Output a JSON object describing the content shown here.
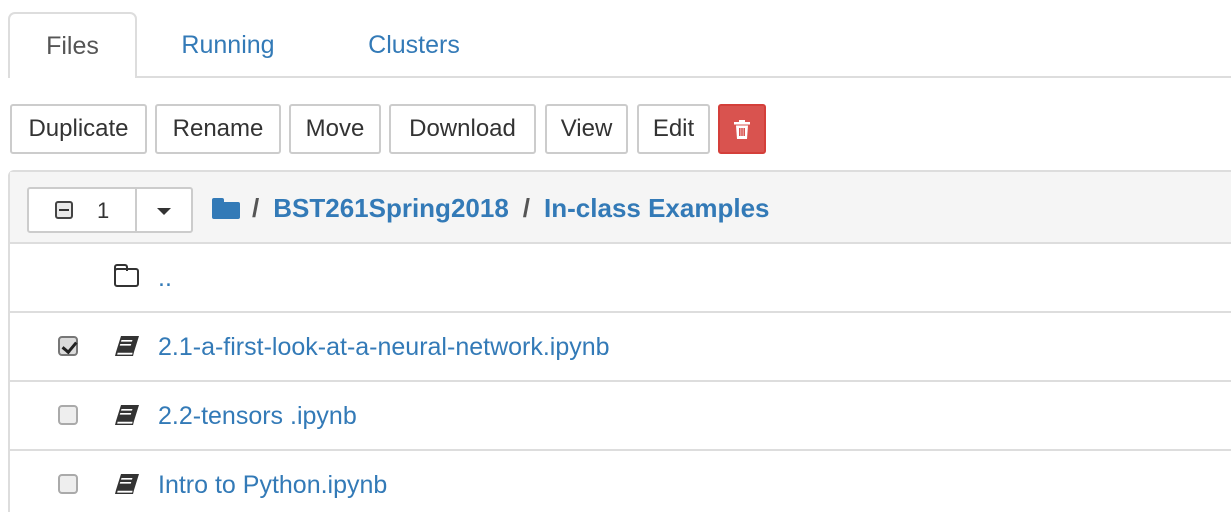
{
  "tabs": [
    {
      "label": "Files",
      "active": true
    },
    {
      "label": "Running",
      "active": false
    },
    {
      "label": "Clusters",
      "active": false
    }
  ],
  "toolbar": {
    "duplicate_label": "Duplicate",
    "rename_label": "Rename",
    "move_label": "Move",
    "download_label": "Download",
    "view_label": "View",
    "edit_label": "Edit",
    "delete_icon": "trash-icon"
  },
  "file_list": {
    "selected_count": "1",
    "breadcrumb": {
      "root_icon": "folder-icon",
      "separator": "/",
      "parts": [
        "BST261Spring2018",
        "In-class Examples"
      ]
    },
    "parent_link": "..",
    "items": [
      {
        "name": "2.1-a-first-look-at-a-neural-network.ipynb",
        "checked": true,
        "icon": "notebook-icon"
      },
      {
        "name": "2.2-tensors .ipynb",
        "checked": false,
        "icon": "notebook-icon"
      },
      {
        "name": "Intro to Python.ipynb",
        "checked": false,
        "icon": "notebook-icon"
      }
    ]
  },
  "colors": {
    "link": "#337ab7",
    "danger": "#d9534f",
    "border": "#dddddd",
    "header_bg": "#f5f5f5"
  }
}
